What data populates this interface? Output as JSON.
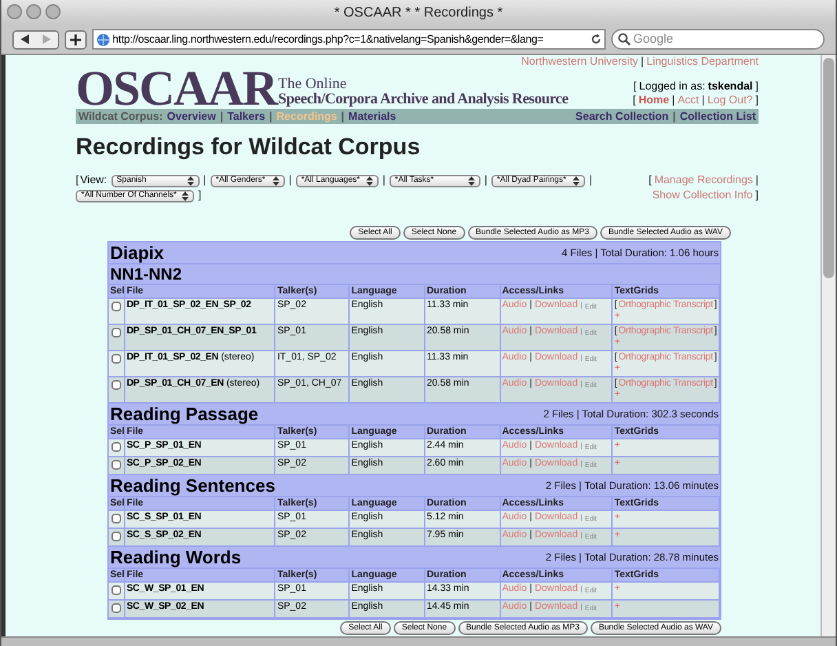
{
  "window": {
    "title": "* OSCAAR * * Recordings *"
  },
  "toolbar": {
    "url": "http://oscaar.ling.northwestern.edu/recordings.php?c=1&nativelang=Spanish&gender=&lang=",
    "search_placeholder": "Google"
  },
  "header": {
    "top_links": [
      {
        "label": "Northwestern University"
      },
      {
        "sep": "|",
        "label": "Linguistics Department"
      }
    ],
    "logo": "OSCAAR",
    "tagline": [
      "The Online",
      "Speech/Corpora Archive and Analysis Resource"
    ],
    "login": {
      "open": "[",
      "label": "Logged in as:",
      "user": "tskendal",
      "close": "]"
    },
    "account_links": [
      {
        "sep": "[",
        "label": "Home"
      },
      {
        "sep": "|",
        "label": "Acct"
      },
      {
        "sep": "|",
        "label": "Log Out?"
      }
    ],
    "account_close": "]"
  },
  "nav": {
    "prefix": "Wildcat Corpus:",
    "items": [
      {
        "label": "Overview",
        "selected": false
      },
      {
        "sep": "|",
        "label": "Talkers",
        "selected": false
      },
      {
        "sep": "|",
        "label": "Recordings",
        "selected": true
      },
      {
        "sep": "|",
        "label": "Materials",
        "selected": false
      }
    ],
    "right_items": [
      {
        "label": "Search Collection"
      },
      {
        "sep": "|",
        "label": "Collection List"
      }
    ]
  },
  "page_title": "Recordings for Wildcat Corpus",
  "filters": {
    "open": "[",
    "label": "View:",
    "selects": [
      {
        "value": "Spanish",
        "after": "|"
      },
      {
        "value": "*All Genders*",
        "after": "|"
      },
      {
        "value": "*All Languages*",
        "after": "|"
      },
      {
        "value": "*All Tasks*",
        "after": "|"
      },
      {
        "value": "*All Dyad Pairings*",
        "after": "|"
      },
      {
        "value": "*All Number Of Channels*",
        "after": "]"
      }
    ],
    "links": [
      {
        "sep": "[",
        "label": "Manage Recordings"
      },
      {
        "sep": "|",
        "label": "Show Collection Info"
      }
    ],
    "links_close": "]"
  },
  "buttons": [
    "Select All",
    "Select None",
    "Bundle Selected Audio as MP3",
    "Bundle Selected Audio as WAV"
  ],
  "sections": [
    {
      "title": "Diapix",
      "summary": "4 Files | Total Duration: 1.06 hours",
      "subtitle": "NN1-NN2",
      "columns": [
        "Sel",
        "File",
        "Talker(s)",
        "Language",
        "Duration",
        "Access/Links",
        "TextGrids"
      ],
      "rows": [
        {
          "checked": false,
          "file": "DP_IT_01_SP_02_EN_SP_02",
          "talkers": "SP_02",
          "language": "English",
          "duration": "11.33 min",
          "audio": "Audio",
          "sep": "|",
          "download": "Download",
          "sep2": "|",
          "edit": "Edit",
          "open": "[",
          "transcript": "Orthographic Transcript",
          "close": "]",
          "add": "+"
        },
        {
          "checked": false,
          "file": "DP_SP_01_CH_07_EN_SP_01",
          "talkers": "SP_01",
          "language": "English",
          "duration": "20.58 min",
          "audio": "Audio",
          "sep": "|",
          "download": "Download",
          "sep2": "|",
          "edit": "Edit",
          "open": "[",
          "transcript": "Orthographic Transcript",
          "close": "]",
          "add": "+"
        },
        {
          "checked": false,
          "file": "DP_IT_01_SP_02_EN",
          "note": "(stereo)",
          "talkers": "IT_01, SP_02",
          "language": "English",
          "duration": "11.33 min",
          "audio": "Audio",
          "sep": "|",
          "download": "Download",
          "sep2": "|",
          "edit": "Edit",
          "open": "[",
          "transcript": "Orthographic Transcript",
          "close": "]",
          "add": "+"
        },
        {
          "checked": false,
          "file": "DP_SP_01_CH_07_EN",
          "note": "(stereo)",
          "talkers": "SP_01, CH_07",
          "language": "English",
          "duration": "20.58 min",
          "audio": "Audio",
          "sep": "|",
          "download": "Download",
          "sep2": "|",
          "edit": "Edit",
          "open": "[",
          "transcript": "Orthographic Transcript",
          "close": "]",
          "add": "+"
        }
      ]
    },
    {
      "title": "Reading Passage",
      "summary": "2 Files | Total Duration: 302.3 seconds",
      "columns": [
        "Sel",
        "File",
        "Talker(s)",
        "Language",
        "Duration",
        "Access/Links",
        "TextGrids"
      ],
      "rows": [
        {
          "checked": false,
          "file": "SC_P_SP_01_EN",
          "talkers": "SP_01",
          "language": "English",
          "duration": "2.44 min",
          "audio": "Audio",
          "sep": "|",
          "download": "Download",
          "sep2": "|",
          "edit": "Edit",
          "add": "+"
        },
        {
          "checked": false,
          "file": "SC_P_SP_02_EN",
          "talkers": "SP_02",
          "language": "English",
          "duration": "2.60 min",
          "audio": "Audio",
          "sep": "|",
          "download": "Download",
          "sep2": "|",
          "edit": "Edit",
          "add": "+"
        }
      ]
    },
    {
      "title": "Reading Sentences",
      "summary": "2 Files | Total Duration: 13.06 minutes",
      "columns": [
        "Sel",
        "File",
        "Talker(s)",
        "Language",
        "Duration",
        "Access/Links",
        "TextGrids"
      ],
      "rows": [
        {
          "checked": false,
          "file": "SC_S_SP_01_EN",
          "talkers": "SP_01",
          "language": "English",
          "duration": "5.12 min",
          "audio": "Audio",
          "sep": "|",
          "download": "Download",
          "sep2": "|",
          "edit": "Edit",
          "add": "+"
        },
        {
          "checked": false,
          "file": "SC_S_SP_02_EN",
          "talkers": "SP_02",
          "language": "English",
          "duration": "7.95 min",
          "audio": "Audio",
          "sep": "|",
          "download": "Download",
          "sep2": "|",
          "edit": "Edit",
          "add": "+"
        }
      ]
    },
    {
      "title": "Reading Words",
      "summary": "2 Files | Total Duration: 28.78 minutes",
      "columns": [
        "Sel",
        "File",
        "Talker(s)",
        "Language",
        "Duration",
        "Access/Links",
        "TextGrids"
      ],
      "rows": [
        {
          "checked": false,
          "file": "SC_W_SP_01_EN",
          "talkers": "SP_01",
          "language": "English",
          "duration": "14.33 min",
          "audio": "Audio",
          "sep": "|",
          "download": "Download",
          "sep2": "|",
          "edit": "Edit",
          "add": "+"
        },
        {
          "checked": false,
          "file": "SC_W_SP_02_EN",
          "talkers": "SP_02",
          "language": "English",
          "duration": "14.45 min",
          "audio": "Audio",
          "sep": "|",
          "download": "Download",
          "sep2": "|",
          "edit": "Edit",
          "add": "+"
        }
      ]
    }
  ],
  "bottom_buttons": [
    "Select All",
    "Select None",
    "Bundle Selected Audio as MP3",
    "Bundle Selected Audio as WAV"
  ]
}
